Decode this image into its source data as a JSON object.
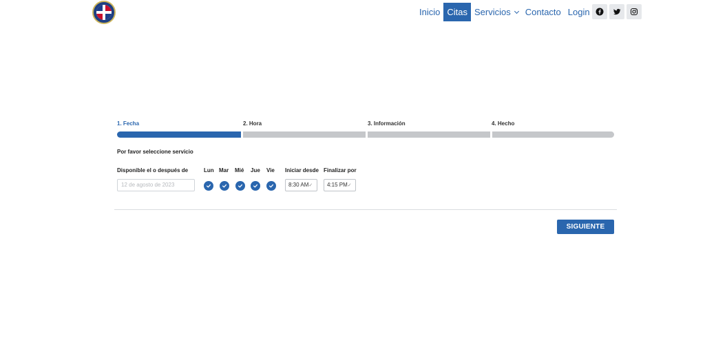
{
  "nav": {
    "items": [
      {
        "label": "Inicio",
        "active": false,
        "dropdown": false
      },
      {
        "label": "Citas",
        "active": true,
        "dropdown": false
      },
      {
        "label": "Servicios",
        "active": false,
        "dropdown": true
      },
      {
        "label": "Contacto",
        "active": false,
        "dropdown": false
      },
      {
        "label": "Login",
        "active": false,
        "dropdown": true
      }
    ],
    "social": [
      "facebook-icon",
      "twitter-icon",
      "instagram-icon"
    ]
  },
  "steps": [
    {
      "label": "1. Fecha",
      "active": true
    },
    {
      "label": "2. Hora",
      "active": false
    },
    {
      "label": "3. Información",
      "active": false
    },
    {
      "label": "4. Hecho",
      "active": false
    }
  ],
  "form": {
    "service_prompt": "Por favor seleccione servicio",
    "date_label": "Disponible el o después de",
    "date_placeholder": "12 de agosto de 2023",
    "days": [
      {
        "label": "Lun",
        "checked": true
      },
      {
        "label": "Mar",
        "checked": true
      },
      {
        "label": "Mié",
        "checked": true
      },
      {
        "label": "Jue",
        "checked": true
      },
      {
        "label": "Vie",
        "checked": true
      }
    ],
    "start_label": "Iniciar desde",
    "end_label": "Finalizar por",
    "start_value": "8:30 AM",
    "end_value": "4:15 PM"
  },
  "next_button": "SIGUIENTE",
  "colors": {
    "accent": "#2a66ae",
    "inactive_bar": "#c5c7ca"
  }
}
